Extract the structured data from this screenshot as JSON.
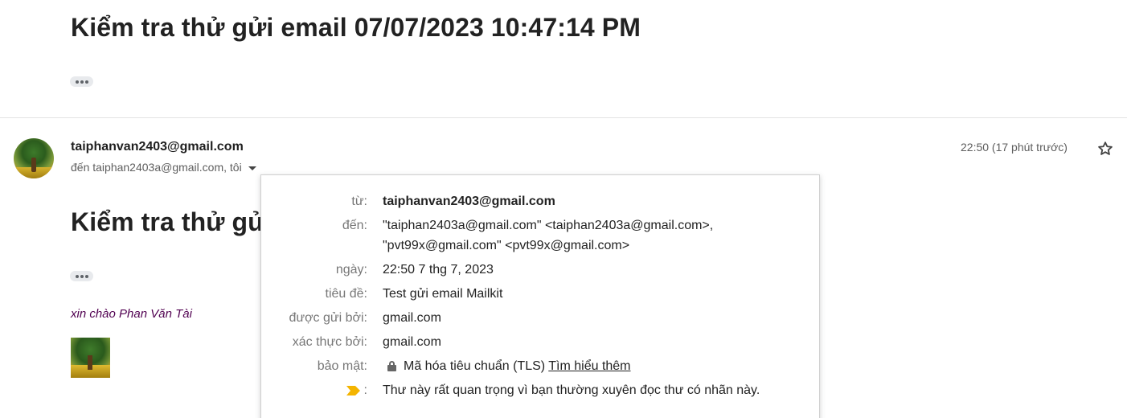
{
  "top_message": {
    "subject": "Kiểm tra thử gửi email 07/07/2023 10:47:14 PM"
  },
  "message": {
    "sender": "taiphanvan2403@gmail.com",
    "to_line": "đến taiphan2403a@gmail.com, tôi",
    "time": "22:50 (17 phút trước)",
    "subject_partial": "Kiểm tra thử gử",
    "greeting": "xin chào Phan Văn Tài"
  },
  "details": {
    "from_label": "từ:",
    "from_value": "taiphanvan2403@gmail.com",
    "to_label": "đến:",
    "to_value_1": "\"taiphan2403a@gmail.com\" <taiphan2403a@gmail.com>,",
    "to_value_2": "\"pvt99x@gmail.com\" <pvt99x@gmail.com>",
    "date_label": "ngày:",
    "date_value": "22:50 7 thg 7, 2023",
    "subject_label": "tiêu đề:",
    "subject_value": "Test gửi email Mailkit",
    "mailed_by_label": "được gửi bởi:",
    "mailed_by_value": "gmail.com",
    "signed_by_label": "xác thực bởi:",
    "signed_by_value": "gmail.com",
    "security_label": "bảo mật:",
    "security_value": "Mã hóa tiêu chuẩn (TLS)",
    "security_link": "Tìm hiểu thêm",
    "importance_label": ":",
    "importance_value": "Thư này rất quan trọng vì bạn thường xuyên đọc thư có nhãn này."
  },
  "icons": {
    "star": "star-outline-icon",
    "lock": "lock-icon",
    "importance": "importance-marker-icon",
    "importance_color": "#f4b400"
  }
}
